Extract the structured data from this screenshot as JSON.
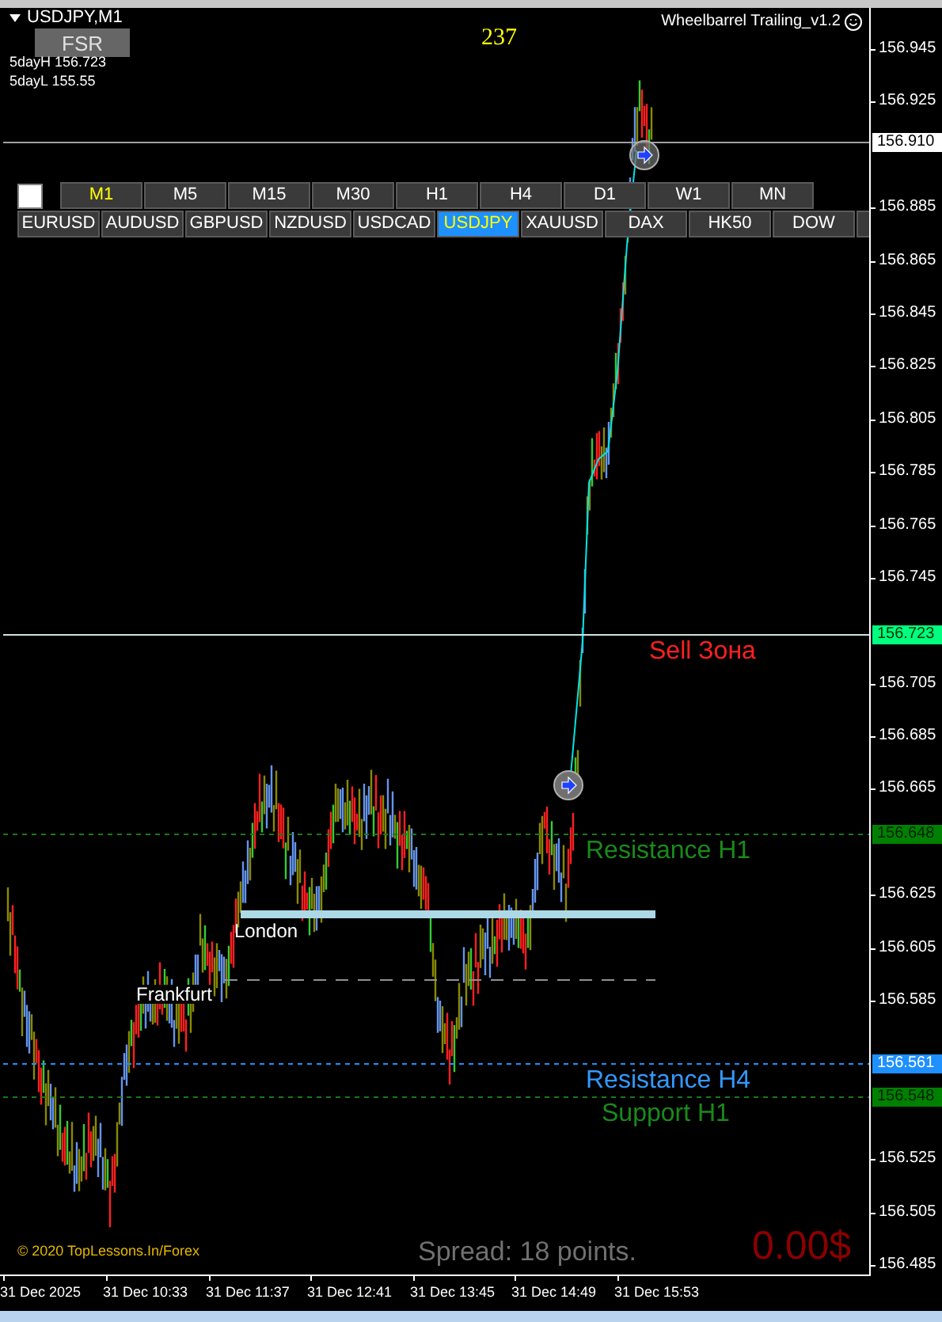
{
  "chart": {
    "symbol_label": "USDJPY,M1",
    "fsr_button": "FSR",
    "day_high": "5dayH 156.723",
    "day_low": "5dayL 155.55",
    "counter": "237",
    "indicator_name": "Wheelbarrel Trailing_v1.2"
  },
  "panel": {
    "checkbox": {
      "checked": false
    },
    "timeframes": [
      {
        "label": "M1",
        "selected": true
      },
      {
        "label": "M5",
        "selected": false
      },
      {
        "label": "M15",
        "selected": false
      },
      {
        "label": "M30",
        "selected": false
      },
      {
        "label": "H1",
        "selected": false
      },
      {
        "label": "H4",
        "selected": false
      },
      {
        "label": "D1",
        "selected": false
      },
      {
        "label": "W1",
        "selected": false
      },
      {
        "label": "MN",
        "selected": false
      }
    ],
    "symbols": [
      {
        "label": "EURUSD",
        "selected": false
      },
      {
        "label": "AUDUSD",
        "selected": false
      },
      {
        "label": "GBPUSD",
        "selected": false
      },
      {
        "label": "NZDUSD",
        "selected": false
      },
      {
        "label": "USDCAD",
        "selected": false
      },
      {
        "label": "USDJPY",
        "selected": true
      },
      {
        "label": "XAUUSD",
        "selected": false
      },
      {
        "label": "DAX",
        "selected": false
      },
      {
        "label": "HK50",
        "selected": false
      },
      {
        "label": "DOW",
        "selected": false
      }
    ]
  },
  "levels": [
    {
      "kind": "current",
      "tag": "156.910",
      "color": "#ffffff"
    },
    {
      "kind": "zone",
      "tag": "156.723",
      "color": "#00ff7f",
      "label": "Sell Зона"
    },
    {
      "kind": "resistance",
      "tag": "156.648",
      "color": "#008000",
      "label": "Resistance H1"
    },
    {
      "kind": "resistance_h4",
      "tag": "156.561",
      "color": "#1e90ff",
      "label": "Resistance H4"
    },
    {
      "kind": "support",
      "tag": "156.548",
      "color": "#008000",
      "label": "Support H1"
    }
  ],
  "sessions": [
    {
      "kind": "bar",
      "label": "London"
    },
    {
      "kind": "dashed",
      "label": "Frankfurt"
    }
  ],
  "price_axis": [
    "156.945",
    "156.925",
    "156.885",
    "156.865",
    "156.845",
    "156.825",
    "156.805",
    "156.785",
    "156.765",
    "156.745",
    "156.705",
    "156.685",
    "156.665",
    "156.625",
    "156.605",
    "156.585",
    "156.525",
    "156.505",
    "156.485"
  ],
  "time_axis": [
    "31 Dec 2025",
    "31 Dec 10:33",
    "31 Dec 11:37",
    "31 Dec 12:41",
    "31 Dec 13:45",
    "31 Dec 14:49",
    "31 Dec 15:53"
  ],
  "footer": {
    "copyright": "© 2020 TopLessons.In/Forex",
    "spread": "Spread: 18 points.",
    "profit": "0.00$"
  }
}
